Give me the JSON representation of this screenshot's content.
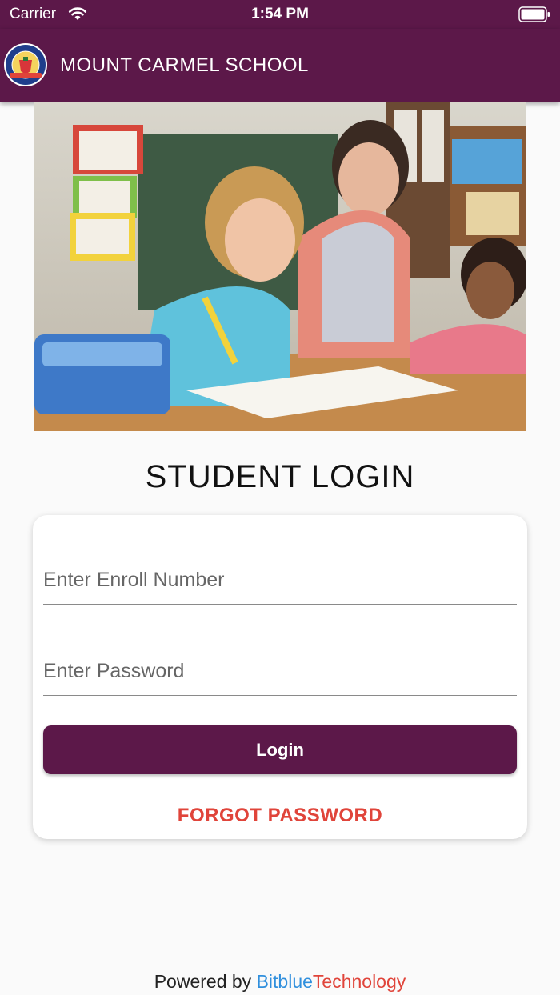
{
  "status_bar": {
    "carrier": "Carrier",
    "time": "1:54 PM"
  },
  "app_bar": {
    "title": "MOUNT CARMEL SCHOOL",
    "color": "#5c1849"
  },
  "page": {
    "title": "STUDENT LOGIN"
  },
  "login_form": {
    "enroll_placeholder": "Enter Enroll Number",
    "password_placeholder": "Enter Password",
    "login_label": "Login",
    "forgot_label": "FORGOT PASSWORD"
  },
  "footer": {
    "prefix": "Powered by",
    "brand_part1": "Bitblue",
    "brand_part2": "Technology"
  },
  "colors": {
    "primary": "#5c1849",
    "accent_red": "#e0443a",
    "accent_blue": "#2f8fdd"
  }
}
